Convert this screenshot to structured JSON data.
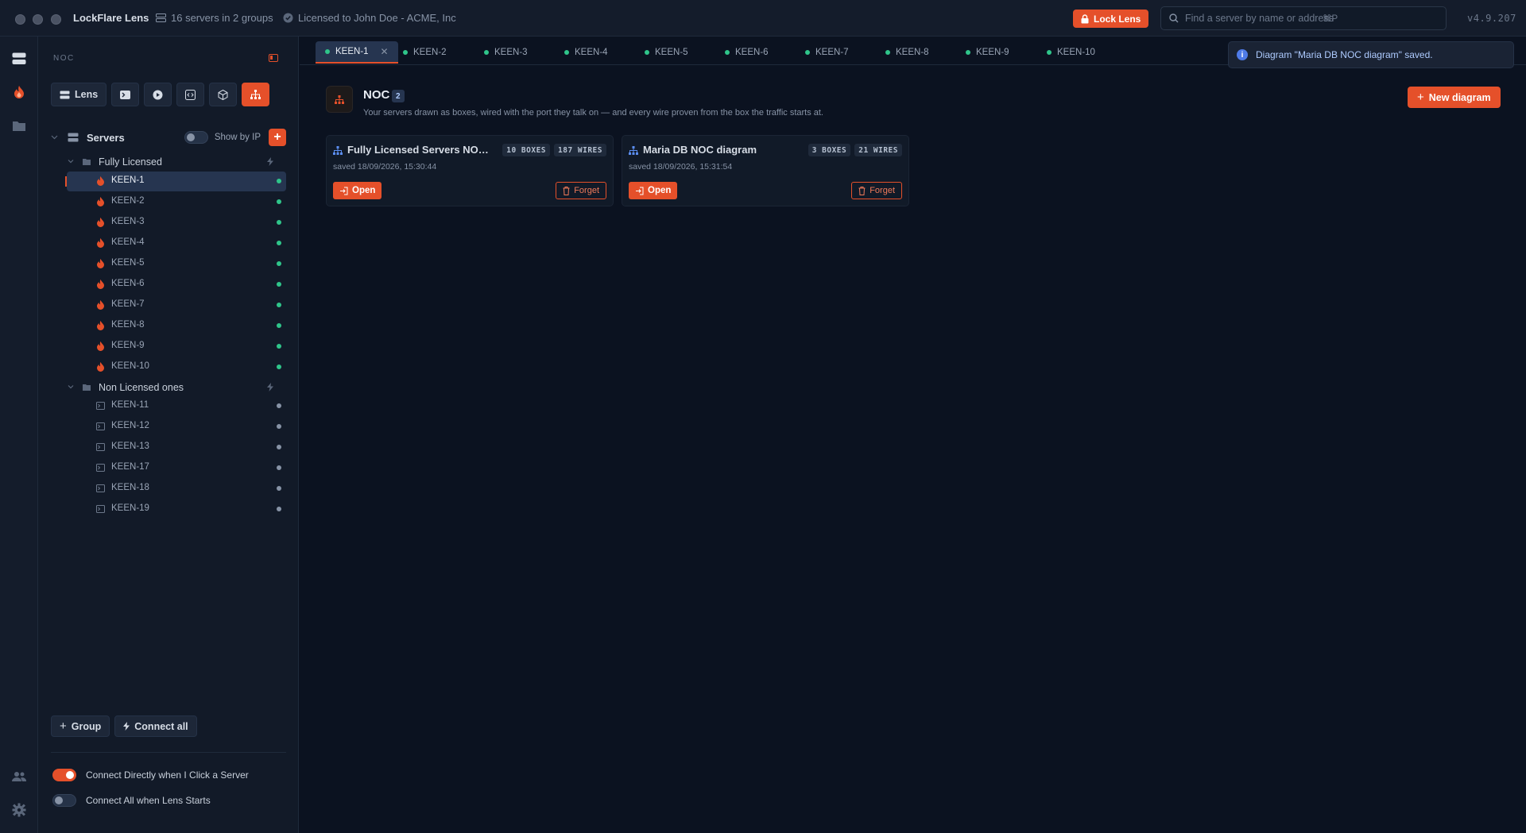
{
  "titlebar": {
    "app_name": "LockFlare Lens",
    "server_count": "16 servers in 2 groups",
    "license": "Licensed to John Doe - ACME, Inc",
    "lock_label": "Lock Lens",
    "search_placeholder": "Find a server by name or address",
    "search_shortcut": "⌘P",
    "version": "v4.9.207"
  },
  "sidebar": {
    "section": "NOC",
    "toolbar": {
      "lens_label": "Lens"
    },
    "servers_title": "Servers",
    "show_by_ip": "Show by IP",
    "groups": [
      {
        "name": "Fully Licensed",
        "servers": [
          "KEEN-1",
          "KEEN-2",
          "KEEN-3",
          "KEEN-4",
          "KEEN-5",
          "KEEN-6",
          "KEEN-7",
          "KEEN-8",
          "KEEN-9",
          "KEEN-10"
        ]
      },
      {
        "name": "Non Licensed ones",
        "servers": [
          "KEEN-11",
          "KEEN-12",
          "KEEN-13",
          "KEEN-17",
          "KEEN-18",
          "KEEN-19"
        ]
      }
    ],
    "selected_server": "KEEN-1",
    "group_button": "Group",
    "connect_all_button": "Connect all",
    "options": [
      {
        "label": "Connect Directly when I Click a Server",
        "on": true
      },
      {
        "label": "Connect All when Lens Starts",
        "on": false
      }
    ]
  },
  "tabs": [
    "KEEN-1",
    "KEEN-2",
    "KEEN-3",
    "KEEN-4",
    "KEEN-5",
    "KEEN-6",
    "KEEN-7",
    "KEEN-8",
    "KEEN-9",
    "KEEN-10"
  ],
  "toast": "Diagram \"Maria DB NOC diagram\" saved.",
  "main": {
    "title": "NOC",
    "count": "2",
    "subtitle": "Your servers drawn as boxes, wired with the port they talk on — and every wire proven from the box the traffic starts at.",
    "new_diagram": "New diagram",
    "diagrams": [
      {
        "name": "Fully Licensed Servers NOC diagram",
        "boxes": "10 BOXES",
        "wires": "187 WIRES",
        "saved": "saved 18/09/2026, 15:30:44"
      },
      {
        "name": "Maria DB NOC diagram",
        "boxes": "3 BOXES",
        "wires": "21 WIRES",
        "saved": "saved 18/09/2026, 15:31:54"
      }
    ],
    "open_label": "Open",
    "forget_label": "Forget"
  },
  "colors": {
    "accent": "#e5502a",
    "online": "#2fc58a",
    "offline": "#8793a6",
    "selected": "#263550"
  }
}
